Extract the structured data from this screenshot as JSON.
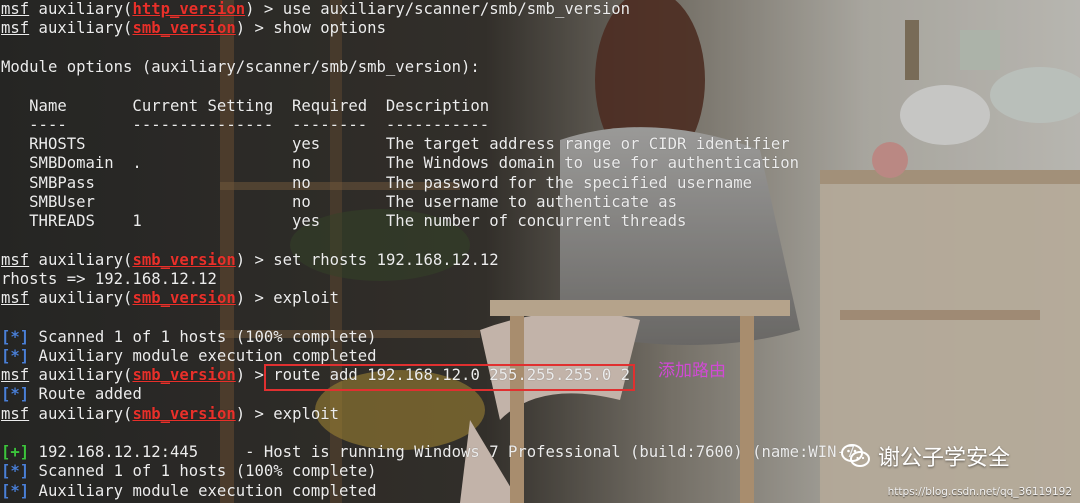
{
  "colors": {
    "prompt_red": "#e8302a",
    "status_blue": "#4a7fd6",
    "status_green": "#3cc43c",
    "highlight": "#e03030",
    "annotation": "#d04ad4"
  },
  "terminal": {
    "msf": "msf",
    "aux": " auxiliary(",
    "close": ") > ",
    "mod_http": "http_version",
    "mod_smb": "smb_version",
    "cmd_use": "use auxiliary/scanner/smb/smb_version",
    "cmd_show": "show options",
    "module_options": "Module options (auxiliary/scanner/smb/smb_version):",
    "table_header": "   Name       Current Setting  Required  Description",
    "table_sep": "   ----       ---------------  --------  -----------",
    "rows": [
      "   RHOSTS                      yes       The target address range or CIDR identifier",
      "   SMBDomain  .                no        The Windows domain to use for authentication",
      "   SMBPass                     no        The password for the specified username",
      "   SMBUser                     no        The username to authenticate as",
      "   THREADS    1                yes       The number of concurrent threads"
    ],
    "cmd_set": "set rhosts 192.168.12.12",
    "rhosts_echo": "rhosts => 192.168.12.12",
    "cmd_exploit": "exploit",
    "status_star": "[*]",
    "status_plus": "[+]",
    "scanned": " Scanned 1 of 1 hosts (100% complete)",
    "aux_completed": " Auxiliary module execution completed",
    "cmd_route": "route add 192.168.12.0 255.255.255.0 2",
    "route_added": " Route added",
    "host_result": " 192.168.12.12:445     - Host is running Windows 7 Professional (build:7600) (name:WIN-7"
  },
  "annotation": "添加路由",
  "watermark": {
    "text": "谢公子学安全",
    "icon": "wechat-icon"
  },
  "url_watermark": "https://blog.csdn.net/qq_36119192"
}
